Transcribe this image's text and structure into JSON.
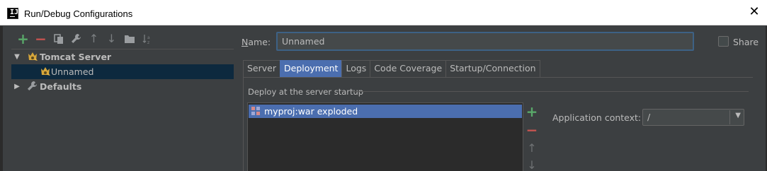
{
  "window": {
    "title": "Run/Debug Configurations",
    "close_glyph": "✕",
    "app_icon_letter": "IJ"
  },
  "toolbar": {
    "items": [
      {
        "name": "add-icon",
        "glyph": "+"
      },
      {
        "name": "remove-icon",
        "glyph": "−"
      },
      {
        "name": "copy-icon",
        "glyph": "❐"
      },
      {
        "name": "wrench-icon",
        "glyph": "🔧"
      },
      {
        "name": "move-up-icon",
        "glyph": "↑"
      },
      {
        "name": "move-down-icon",
        "glyph": "↓"
      },
      {
        "name": "folder-icon",
        "glyph": "▬"
      },
      {
        "name": "sort-icon",
        "glyph": "⇅"
      }
    ]
  },
  "tree": {
    "items": [
      {
        "label": "Tomcat Server",
        "expanded": true,
        "bold": true,
        "level": 0,
        "selected": false
      },
      {
        "label": "Unnamed",
        "bold": false,
        "level": 1,
        "selected": true
      },
      {
        "label": "Defaults",
        "expanded": false,
        "bold": true,
        "level": 0,
        "selected": false
      }
    ]
  },
  "form": {
    "name_label_prefix": "",
    "name_label_underlined": "N",
    "name_label_rest": "ame:",
    "name_value": "Unnamed",
    "share_label": "Share",
    "share_checked": false
  },
  "tabs": [
    {
      "label": "Server",
      "active": false
    },
    {
      "label": "Deployment",
      "active": true
    },
    {
      "label": "Logs",
      "active": false
    },
    {
      "label": "Code Coverage",
      "active": false
    },
    {
      "label": "Startup/Connection",
      "active": false
    }
  ],
  "deployment": {
    "section_label": "Deploy at the server startup",
    "artifacts": [
      {
        "label": "myproj:war exploded",
        "selected": true
      }
    ],
    "side_buttons": [
      {
        "name": "add-artifact-icon",
        "glyph": "+"
      },
      {
        "name": "remove-artifact-icon",
        "glyph": "−"
      },
      {
        "name": "move-up-icon",
        "glyph": "↑"
      },
      {
        "name": "move-down-icon",
        "glyph": "↓"
      }
    ],
    "app_context_label": "Application context:",
    "app_context_value": "/"
  },
  "colors": {
    "background": "#3c3f41",
    "selection": "#4b6eaf",
    "tree_selection": "#0d293e",
    "add": "#59a869",
    "remove": "#c75450",
    "text": "#bbbbbb",
    "focus_border": "#3d6185"
  }
}
